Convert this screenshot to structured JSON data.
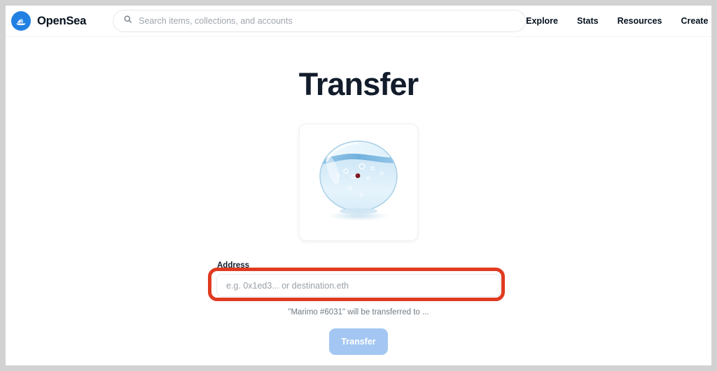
{
  "header": {
    "brand": {
      "name": "OpenSea",
      "logo_icon": "opensea-sailboat-logo",
      "logo_color": "#2081e2"
    },
    "search": {
      "icon": "search-icon",
      "placeholder": "Search items, collections, and accounts",
      "value": ""
    },
    "nav": [
      {
        "label": "Explore"
      },
      {
        "label": "Stats"
      },
      {
        "label": "Resources"
      },
      {
        "label": "Create"
      }
    ]
  },
  "main": {
    "title": "Transfer",
    "asset": {
      "image_alt": "Marimo #6031 fishbowl artwork",
      "icon": "fishbowl-image"
    },
    "form": {
      "address_label": "Address",
      "address_placeholder": "e.g. 0x1ed3... or destination.eth",
      "address_value": "",
      "helper_text": "\"Marimo #6031\" will be transferred to ...",
      "submit_label": "Transfer"
    },
    "annotation": {
      "target": "address-input",
      "color": "#e03a20"
    }
  },
  "colors": {
    "brand_blue": "#2081e2",
    "text_dark": "#04111d",
    "title_dark": "#121c2b",
    "muted": "#707a83",
    "button_disabled": "#a3c7f2",
    "annotation_red": "#e03a20",
    "frame_gray": "#d2d2d2"
  }
}
